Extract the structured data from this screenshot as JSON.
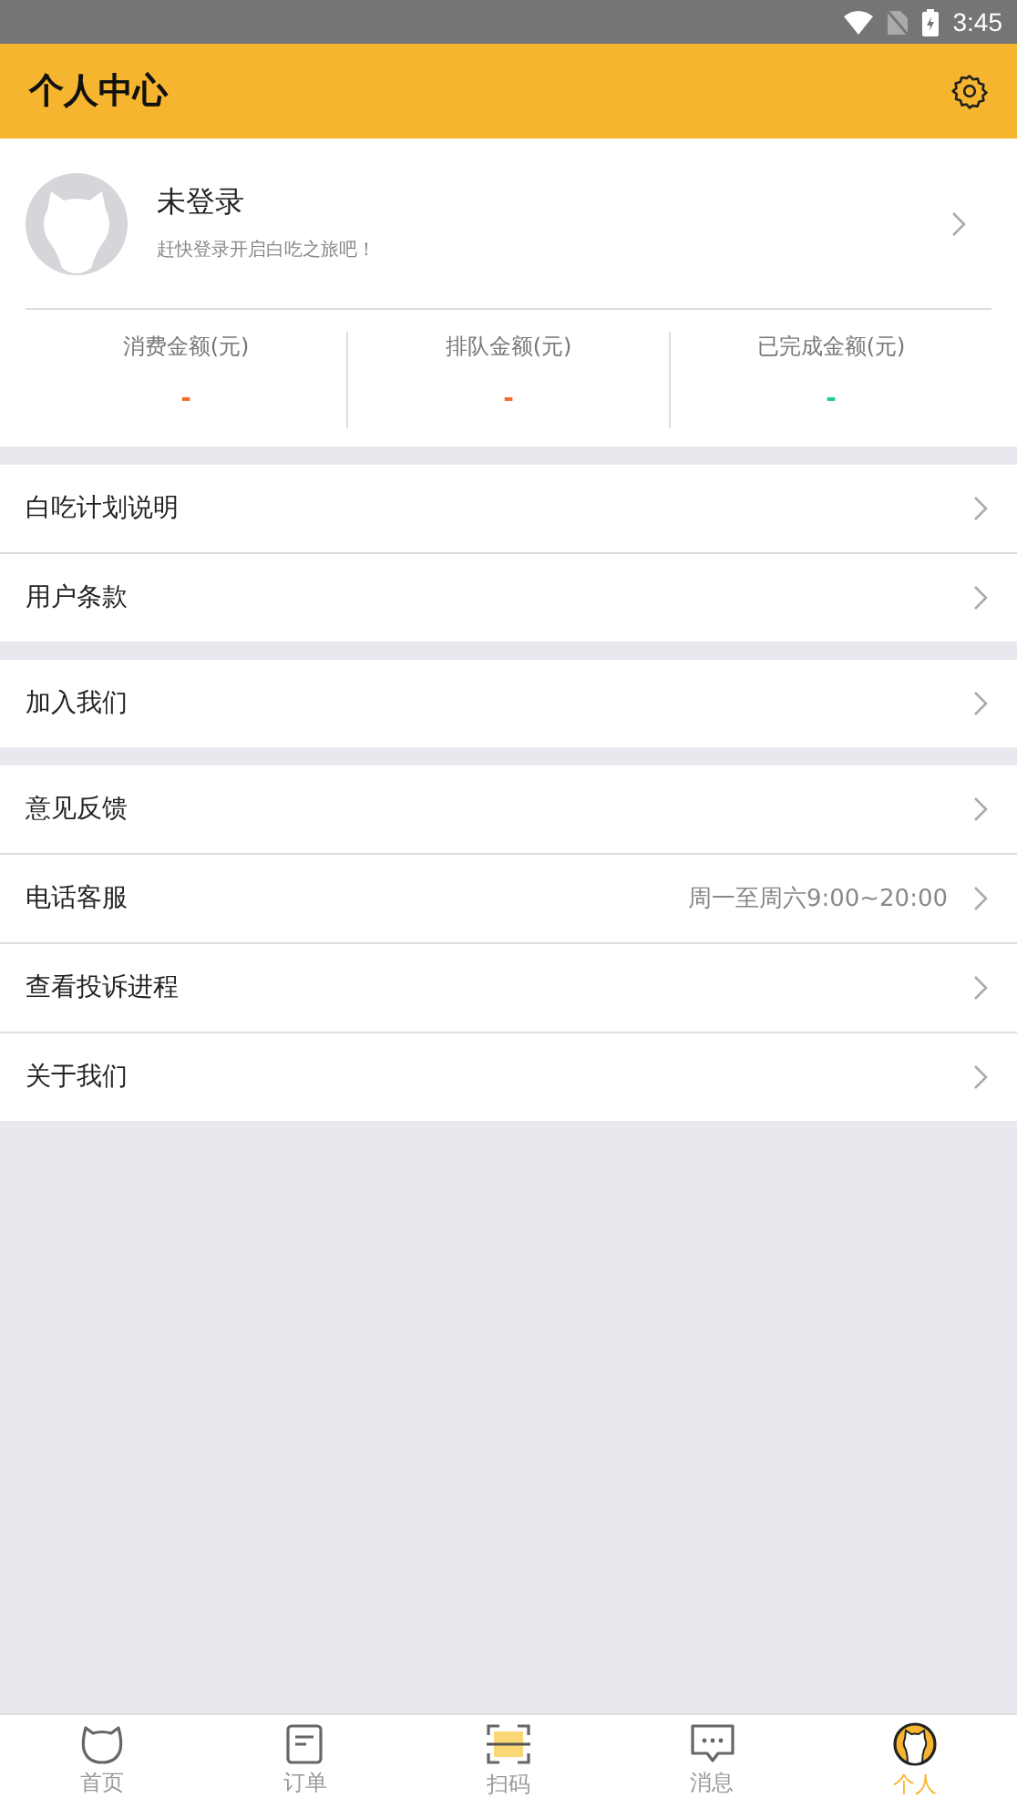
{
  "status_bar": {
    "time": "3:45"
  },
  "header": {
    "title": "个人中心"
  },
  "profile": {
    "name": "未登录",
    "subtitle": "赶快登录开启白吃之旅吧！"
  },
  "stats": [
    {
      "label": "消费金额(元)",
      "value": "-",
      "color": "#f26b2a"
    },
    {
      "label": "排队金额(元)",
      "value": "-",
      "color": "#f26b2a"
    },
    {
      "label": "已完成金额(元)",
      "value": "-",
      "color": "#1ccb9a"
    }
  ],
  "menu_groups": [
    [
      {
        "label": "白吃计划说明"
      },
      {
        "label": "用户条款"
      }
    ],
    [
      {
        "label": "加入我们"
      }
    ],
    [
      {
        "label": "意见反馈"
      },
      {
        "label": "电话客服",
        "detail": "周一至周六9:00~20:00"
      },
      {
        "label": "查看投诉进程"
      },
      {
        "label": "关于我们"
      }
    ]
  ],
  "tabs": [
    {
      "label": "首页",
      "kind": "home",
      "selected": false
    },
    {
      "label": "订单",
      "kind": "order",
      "selected": false
    },
    {
      "label": "扫码",
      "kind": "scan",
      "selected": false
    },
    {
      "label": "消息",
      "kind": "message",
      "selected": false
    },
    {
      "label": "个人",
      "kind": "profile",
      "selected": true
    }
  ]
}
